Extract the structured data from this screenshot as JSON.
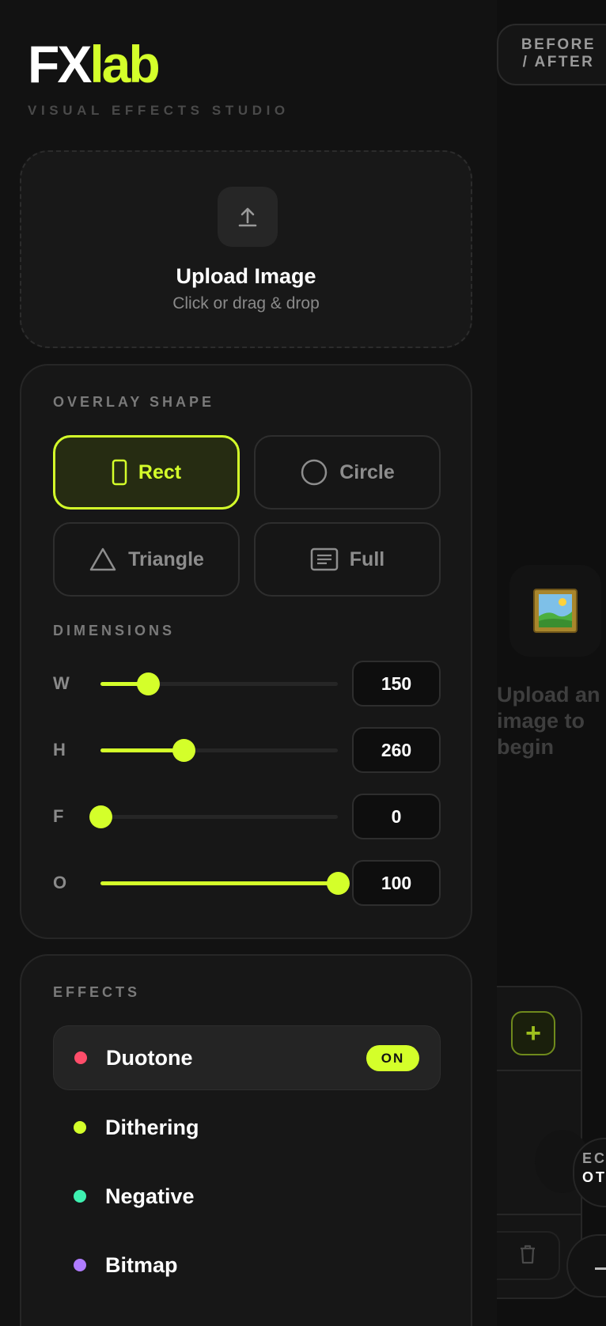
{
  "app": {
    "logo_fx": "FX",
    "logo_lab": "lab",
    "tagline": "VISUAL EFFECTS STUDIO",
    "accent_color": "#d4ff2a"
  },
  "upload": {
    "icon": "upload-arrow-icon",
    "title": "Upload Image",
    "subtitle": "Click or drag & drop"
  },
  "overlay_shape": {
    "label": "OVERLAY SHAPE",
    "selected": "Rect",
    "options": [
      {
        "label": "Rect",
        "icon": "rect-icon"
      },
      {
        "label": "Circle",
        "icon": "circle-icon"
      },
      {
        "label": "Triangle",
        "icon": "triangle-icon"
      },
      {
        "label": "Full",
        "icon": "full-frame-icon"
      }
    ]
  },
  "dimensions": {
    "label": "DIMENSIONS",
    "sliders": [
      {
        "label": "W",
        "value": "150",
        "fraction": 0.2
      },
      {
        "label": "H",
        "value": "260",
        "fraction": 0.35
      },
      {
        "label": "F",
        "value": "0",
        "fraction": 0.0
      },
      {
        "label": "O",
        "value": "100",
        "fraction": 1.0
      }
    ]
  },
  "effects": {
    "label": "EFFECTS",
    "items": [
      {
        "name": "Duotone",
        "color": "#ff4d6a",
        "active": true,
        "badge": "ON"
      },
      {
        "name": "Dithering",
        "color": "#d4ff2a",
        "active": false
      },
      {
        "name": "Negative",
        "color": "#3ef0b0",
        "active": false
      },
      {
        "name": "Bitmap",
        "color": "#b07cff",
        "active": false
      }
    ]
  },
  "preview": {
    "toggle_label": "BEFORE / AFTER",
    "placeholder_icon": "framed-picture-icon",
    "placeholder_text": "Upload an image to begin"
  },
  "layers": {
    "add_icon": "plus-icon",
    "delete_icon": "trash-icon"
  },
  "peek": {
    "line1": "EC",
    "line2": "OTO"
  }
}
